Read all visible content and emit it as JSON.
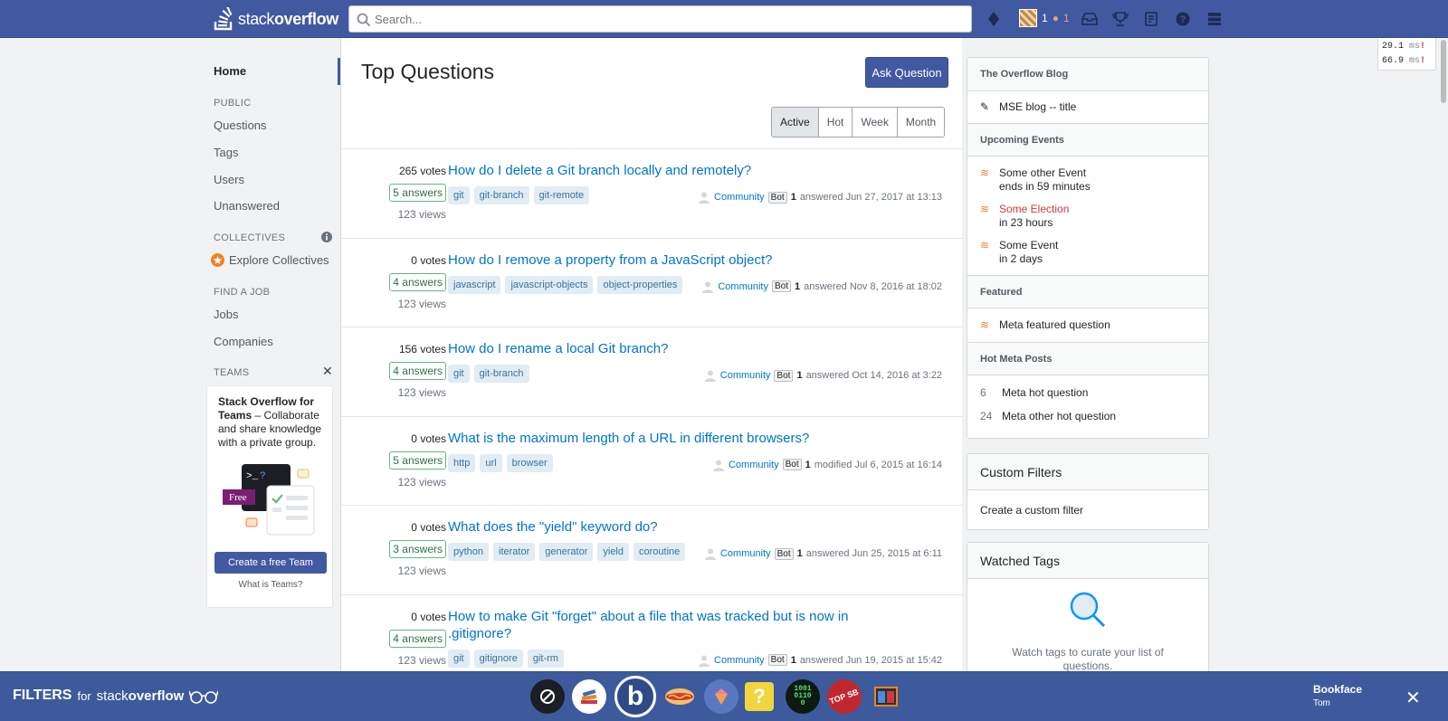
{
  "topbar": {
    "logo": {
      "text_prefix": "stack",
      "text_suffix": "overflow"
    },
    "search": {
      "placeholder": "Search..."
    },
    "reputation": "1",
    "bronze_badges": "1",
    "icons": [
      "diamond-icon",
      "inbox-icon",
      "achievements-icon",
      "review-icon",
      "help-icon",
      "site-switcher-icon"
    ]
  },
  "perf": {
    "a": "29.1",
    "b": "66.9",
    "unit": "ms",
    "flag": "!"
  },
  "leftnav": {
    "home": "Home",
    "public_heading": "PUBLIC",
    "questions": "Questions",
    "tags": "Tags",
    "users": "Users",
    "unanswered": "Unanswered",
    "collectives_heading": "COLLECTIVES",
    "explore_collectives": "Explore Collectives",
    "job_heading": "FIND A JOB",
    "jobs": "Jobs",
    "companies": "Companies",
    "teams_heading": "TEAMS",
    "teams_title": "Stack Overflow for Teams",
    "teams_text": "– Collaborate and share knowledge with a private group.",
    "free_label": "Free",
    "create_team": "Create a free Team",
    "what_is_teams": "What is Teams?"
  },
  "main": {
    "title": "Top Questions",
    "ask_button": "Ask Question",
    "tabs": [
      "Active",
      "Hot",
      "Week",
      "Month"
    ],
    "questions": [
      {
        "votes": "265",
        "votes_label": "votes",
        "answers": "5 answers",
        "views": "123 views",
        "title": "How do I delete a Git branch locally and remotely?",
        "tags": [
          "git",
          "git-branch",
          "git-remote"
        ],
        "user": "Community",
        "bot": "Bot",
        "rep": "1",
        "action": "answered Jun 27, 2017 at 13:13"
      },
      {
        "votes": "0",
        "votes_label": "votes",
        "answers": "4 answers",
        "views": "123 views",
        "title": "How do I remove a property from a JavaScript object?",
        "tags": [
          "javascript",
          "javascript-objects",
          "object-properties"
        ],
        "user": "Community",
        "bot": "Bot",
        "rep": "1",
        "action": "answered Nov 8, 2016 at 18:02"
      },
      {
        "votes": "156",
        "votes_label": "votes",
        "answers": "4 answers",
        "views": "123 views",
        "title": "How do I rename a local Git branch?",
        "tags": [
          "git",
          "git-branch"
        ],
        "user": "Community",
        "bot": "Bot",
        "rep": "1",
        "action": "answered Oct 14, 2016 at 3:22"
      },
      {
        "votes": "0",
        "votes_label": "votes",
        "answers": "5 answers",
        "views": "123 views",
        "title": "What is the maximum length of a URL in different browsers?",
        "tags": [
          "http",
          "url",
          "browser"
        ],
        "user": "Community",
        "bot": "Bot",
        "rep": "1",
        "action": "modified Jul 6, 2015 at 16:14"
      },
      {
        "votes": "0",
        "votes_label": "votes",
        "answers": "3 answers",
        "views": "123 views",
        "title": "What does the \"yield\" keyword do?",
        "tags": [
          "python",
          "iterator",
          "generator",
          "yield",
          "coroutine"
        ],
        "user": "Community",
        "bot": "Bot",
        "rep": "1",
        "action": "answered Jun 25, 2015 at 6:11"
      },
      {
        "votes": "0",
        "votes_label": "votes",
        "answers": "4 answers",
        "views": "123 views",
        "title": "How to make Git \"forget\" about a file that was tracked but is now in .gitignore?",
        "tags": [
          "git",
          "gitignore",
          "git-rm"
        ],
        "user": "Community",
        "bot": "Bot",
        "rep": "1",
        "action": "answered Jun 19, 2015 at 15:42"
      }
    ]
  },
  "sidebar": {
    "blog_heading": "The Overflow Blog",
    "blog_item": "MSE blog -- title",
    "events_heading": "Upcoming Events",
    "event1_name": "Some other Event",
    "event1_time": "ends in 59 minutes",
    "event2_name": "Some Election",
    "event2_time": "in 23 hours",
    "event3_name": "Some Event",
    "event3_time": "in 2 days",
    "featured_heading": "Featured",
    "featured_item": "Meta featured question",
    "hotmeta_heading": "Hot Meta Posts",
    "hot1_num": "6",
    "hot1": "Meta hot question",
    "hot2_num": "24",
    "hot2": "Meta other hot question",
    "custom_filters_heading": "Custom Filters",
    "create_filter": "Create a custom filter",
    "watched_tags_heading": "Watched Tags",
    "watched_tags_text": "Watch tags to curate your list of questions."
  },
  "filterbar": {
    "brand_prefix": "FILTERS",
    "brand_for": "for",
    "brand_site_a": "stack",
    "brand_site_b": "overflow",
    "user_name": "Bookface",
    "user_sub": "Tom",
    "site_icons": [
      "block-icon",
      "stack-icon",
      "b-icon",
      "hotdog-icon",
      "gem-icon",
      "question-icon",
      "binary-icon",
      "top-sb-icon",
      "window-icon"
    ]
  }
}
